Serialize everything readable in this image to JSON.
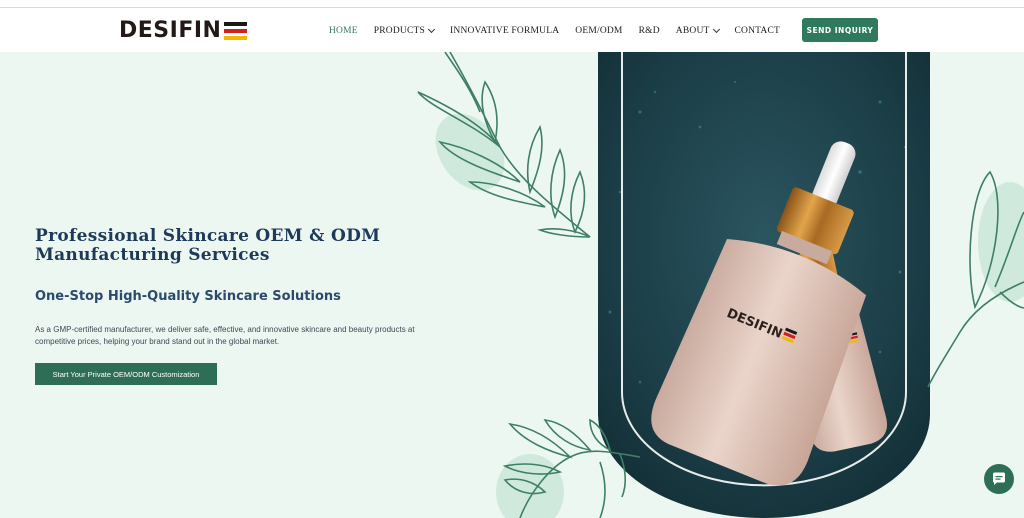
{
  "brand": {
    "logo_text": "DESIFIN",
    "flag_colors": [
      "#1a1a1a",
      "#d21f1f",
      "#f2b705"
    ]
  },
  "nav": {
    "items": [
      {
        "label": "HOME",
        "active": true,
        "has_dropdown": false
      },
      {
        "label": "PRODUCTS",
        "active": false,
        "has_dropdown": true
      },
      {
        "label": "INNOVATIVE FORMULA",
        "active": false,
        "has_dropdown": false
      },
      {
        "label": "OEM/ODM",
        "active": false,
        "has_dropdown": false
      },
      {
        "label": "R&D",
        "active": false,
        "has_dropdown": false
      },
      {
        "label": "ABOUT",
        "active": false,
        "has_dropdown": true
      },
      {
        "label": "CONTACT",
        "active": false,
        "has_dropdown": false
      }
    ],
    "inquiry_label": "SEND INQUIRY"
  },
  "hero": {
    "title": "Professional Skincare OEM & ODM Manufacturing Services",
    "subtitle": "One-Stop High-Quality Skincare Solutions",
    "description": "As a GMP-certified manufacturer, we deliver safe, effective, and innovative skincare and beauty products at competitive prices, helping your brand stand out in the global market.",
    "cta_label": "Start Your Private OEM/ODM Customization"
  },
  "product_image": {
    "bottle_brand": "DESIFIN"
  },
  "colors": {
    "accent": "#2f7a5e",
    "hero_bg": "#edf7f2",
    "title": "#1e3a5a",
    "arch_bg": "#183840"
  },
  "icons": {
    "chat": "chat-bubble-icon",
    "dropdown": "chevron-down-icon"
  }
}
